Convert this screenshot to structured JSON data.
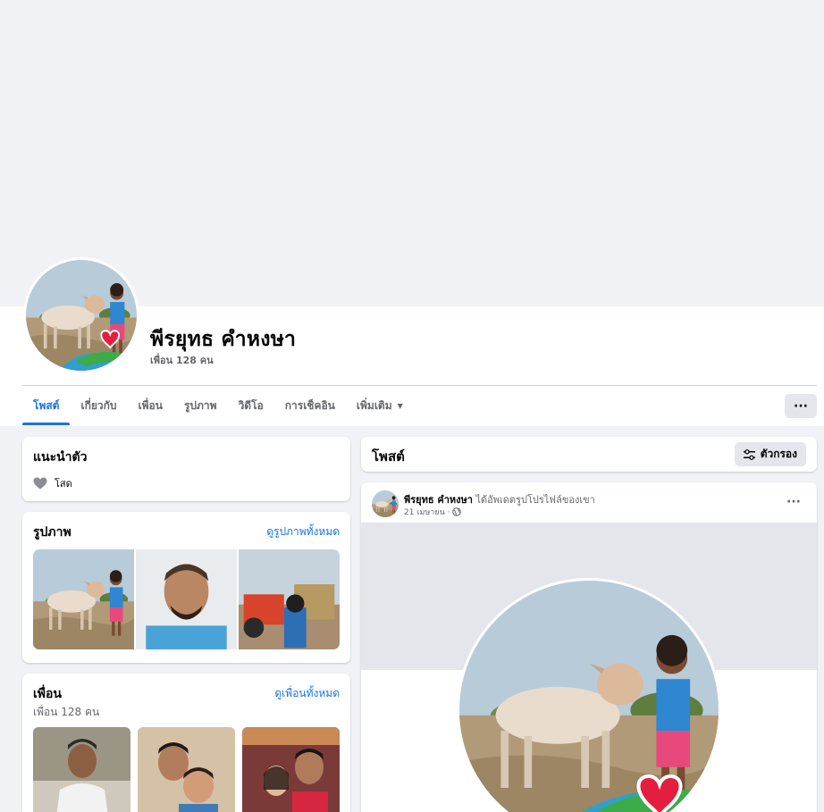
{
  "profile": {
    "name": "พีรยุทธ คำหงษา",
    "friend_count": "เพื่อน 128 คน"
  },
  "tabs": [
    {
      "label": "โพสต์",
      "active": true
    },
    {
      "label": "เกี่ยวกับ"
    },
    {
      "label": "เพื่อน"
    },
    {
      "label": "รูปภาพ"
    },
    {
      "label": "วิดีโอ"
    },
    {
      "label": "การเช็คอิน"
    },
    {
      "label": "เพิ่มเติม"
    }
  ],
  "more_button": "···",
  "intro": {
    "title": "แนะนำตัว",
    "relationship": "โสด",
    "relationship_icon": "heart-icon"
  },
  "photos": {
    "title": "รูปภาพ",
    "see_all": "ดูรูปภาพทั้งหมด"
  },
  "friends": {
    "title": "เพื่อน",
    "see_all": "ดูเพื่อนทั้งหมด",
    "count": "เพื่อน 128 คน"
  },
  "posts": {
    "title": "โพสต์",
    "filter_label": "ตัวกรอง"
  },
  "post": {
    "author": "พีรยุทธ คำหงษา",
    "action": "ได้อัพเดตรูปโปรไฟล์ของเขา",
    "date": "21 เมษายน ·",
    "privacy_icon": "globe-icon",
    "menu": "···"
  },
  "colors": {
    "accent": "#1b74e4",
    "background": "#f0f2f5",
    "secondary_text": "#65676b",
    "heart_frame": "#e41e3f"
  }
}
